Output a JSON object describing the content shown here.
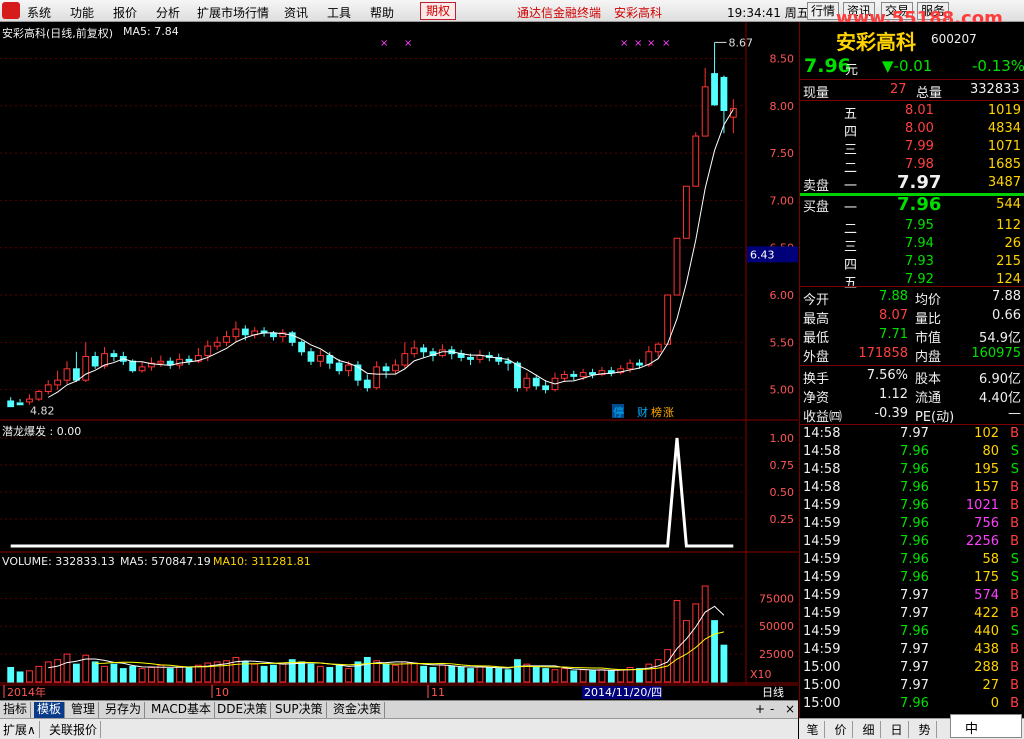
{
  "menu": {
    "items": [
      "系统",
      "功能",
      "报价",
      "分析",
      "扩展市场行情",
      "资讯",
      "工具",
      "帮助"
    ],
    "qq": "期权",
    "marquee1": "通达信金融终端",
    "marquee2": "安彩高科",
    "clock": "19:34:41 周五",
    "tb": [
      "行情",
      "资讯",
      "交易",
      "服务"
    ],
    "watermark": "www.55188.com"
  },
  "chart": {
    "main_title": "安彩高科(日线,前复权)",
    "ma_label": "MA5: 7.84",
    "high_marker": "8.67",
    "low_marker": "4.82",
    "y_ticks": [
      "8.50",
      "8.00",
      "7.50",
      "7.00",
      "6.50",
      "6.00",
      "5.50",
      "5.00"
    ],
    "cursor_price": "6.43",
    "events": [
      "停",
      "财",
      "榜",
      "涨"
    ],
    "ind_title": "潜龙爆发 : 0.00",
    "ind_ticks": [
      "1.00",
      "0.75",
      "0.50",
      "0.25"
    ],
    "vol_title": "VOLUME: 332833.13",
    "vol_ma5": "MA5: 570847.19",
    "vol_ma10": "MA10: 311281.81",
    "vol_ticks": [
      "75000",
      "50000",
      "25000"
    ],
    "vol_unit": "X10",
    "x_labels": [
      "2014年",
      "10",
      "11"
    ],
    "x_cursor": "2014/11/20/四",
    "period": "日线"
  },
  "chart_data": {
    "type": "candlestick",
    "candles": [
      [
        4.88,
        4.82,
        4.92,
        4.86
      ],
      [
        4.86,
        4.84,
        4.9,
        4.87
      ],
      [
        4.87,
        4.9,
        4.95,
        4.84
      ],
      [
        4.9,
        4.98,
        5.0,
        4.88
      ],
      [
        4.98,
        5.05,
        5.1,
        4.95
      ],
      [
        5.05,
        5.1,
        5.2,
        5.0
      ],
      [
        5.1,
        5.22,
        5.3,
        5.06
      ],
      [
        5.22,
        5.1,
        5.4,
        5.08
      ],
      [
        5.1,
        5.35,
        5.5,
        5.08
      ],
      [
        5.35,
        5.25,
        5.4,
        5.22
      ],
      [
        5.25,
        5.38,
        5.45,
        5.22
      ],
      [
        5.38,
        5.35,
        5.42,
        5.3
      ],
      [
        5.35,
        5.3,
        5.4,
        5.26
      ],
      [
        5.3,
        5.2,
        5.32,
        5.18
      ],
      [
        5.2,
        5.24,
        5.3,
        5.18
      ],
      [
        5.24,
        5.28,
        5.34,
        5.2
      ],
      [
        5.28,
        5.3,
        5.36,
        5.24
      ],
      [
        5.3,
        5.26,
        5.34,
        5.22
      ],
      [
        5.26,
        5.32,
        5.38,
        5.22
      ],
      [
        5.32,
        5.3,
        5.36,
        5.26
      ],
      [
        5.3,
        5.36,
        5.44,
        5.28
      ],
      [
        5.36,
        5.46,
        5.52,
        5.3
      ],
      [
        5.46,
        5.5,
        5.56,
        5.42
      ],
      [
        5.5,
        5.56,
        5.62,
        5.46
      ],
      [
        5.56,
        5.64,
        5.72,
        5.5
      ],
      [
        5.64,
        5.58,
        5.68,
        5.52
      ],
      [
        5.58,
        5.62,
        5.66,
        5.54
      ],
      [
        5.62,
        5.6,
        5.66,
        5.56
      ],
      [
        5.6,
        5.56,
        5.62,
        5.52
      ],
      [
        5.56,
        5.6,
        5.64,
        5.5
      ],
      [
        5.6,
        5.5,
        5.62,
        5.46
      ],
      [
        5.5,
        5.4,
        5.52,
        5.36
      ],
      [
        5.4,
        5.3,
        5.44,
        5.26
      ],
      [
        5.3,
        5.36,
        5.42,
        5.24
      ],
      [
        5.36,
        5.28,
        5.4,
        5.22
      ],
      [
        5.28,
        5.2,
        5.32,
        5.16
      ],
      [
        5.2,
        5.26,
        5.3,
        5.14
      ],
      [
        5.26,
        5.1,
        5.3,
        5.04
      ],
      [
        5.1,
        5.02,
        5.16,
        4.98
      ],
      [
        5.02,
        5.24,
        5.3,
        5.0
      ],
      [
        5.24,
        5.2,
        5.28,
        5.12
      ],
      [
        5.2,
        5.26,
        5.32,
        5.16
      ],
      [
        5.26,
        5.38,
        5.5,
        5.22
      ],
      [
        5.38,
        5.44,
        5.52,
        5.34
      ],
      [
        5.44,
        5.4,
        5.48,
        5.34
      ],
      [
        5.4,
        5.36,
        5.44,
        5.3
      ],
      [
        5.36,
        5.42,
        5.48,
        5.34
      ],
      [
        5.42,
        5.38,
        5.46,
        5.32
      ],
      [
        5.38,
        5.34,
        5.42,
        5.3
      ],
      [
        5.34,
        5.32,
        5.38,
        5.26
      ],
      [
        5.32,
        5.36,
        5.42,
        5.28
      ],
      [
        5.36,
        5.34,
        5.4,
        5.3
      ],
      [
        5.34,
        5.3,
        5.38,
        5.26
      ],
      [
        5.3,
        5.28,
        5.34,
        5.2
      ],
      [
        5.28,
        5.02,
        5.3,
        4.98
      ],
      [
        5.02,
        5.12,
        5.18,
        4.98
      ],
      [
        5.12,
        5.04,
        5.16,
        5.0
      ],
      [
        5.04,
        5.0,
        5.1,
        4.96
      ],
      [
        5.0,
        5.12,
        5.18,
        4.98
      ],
      [
        5.12,
        5.16,
        5.2,
        5.08
      ],
      [
        5.16,
        5.14,
        5.2,
        5.1
      ],
      [
        5.14,
        5.18,
        5.22,
        5.1
      ],
      [
        5.18,
        5.16,
        5.22,
        5.12
      ],
      [
        5.16,
        5.2,
        5.24,
        5.14
      ],
      [
        5.2,
        5.18,
        5.24,
        5.14
      ],
      [
        5.18,
        5.22,
        5.26,
        5.16
      ],
      [
        5.22,
        5.28,
        5.32,
        5.18
      ],
      [
        5.28,
        5.26,
        5.32,
        5.22
      ],
      [
        5.26,
        5.4,
        5.46,
        5.24
      ],
      [
        5.4,
        5.48,
        5.5,
        5.34
      ],
      [
        5.48,
        6.0,
        6.0,
        5.48
      ],
      [
        6.0,
        6.6,
        6.6,
        6.0
      ],
      [
        6.6,
        7.15,
        7.15,
        6.88
      ],
      [
        7.15,
        7.68,
        7.72,
        7.15
      ],
      [
        7.68,
        8.2,
        8.4,
        7.68
      ],
      [
        8.34,
        8.01,
        8.67,
        8.0
      ],
      [
        8.3,
        7.95,
        8.32,
        7.71
      ],
      [
        7.88,
        7.97,
        8.07,
        7.71
      ]
    ],
    "vol": [
      13,
      9,
      10,
      14,
      18,
      20,
      25,
      16,
      24,
      18,
      14,
      16,
      12,
      14,
      12,
      13,
      15,
      12,
      14,
      13,
      15,
      17,
      18,
      19,
      22,
      18,
      16,
      14,
      15,
      17,
      20,
      18,
      16,
      14,
      13,
      15,
      12,
      18,
      22,
      19,
      16,
      15,
      18,
      17,
      14,
      13,
      15,
      14,
      13,
      12,
      14,
      13,
      12,
      11,
      20,
      16,
      13,
      12,
      11,
      12,
      10,
      11,
      10,
      11,
      10,
      11,
      13,
      12,
      16,
      20,
      29,
      73,
      55,
      70,
      86,
      55,
      33
    ],
    "ma5_end": 7.84,
    "vol_ma5": 570847.19,
    "vol_ma10": 311281.81
  },
  "quote": {
    "name": "安彩高科",
    "code": "600207",
    "price": "7.96",
    "yuan": "元",
    "chg": "▼-0.01",
    "pct": "-0.13%",
    "xl_label": "现量",
    "xl": "27",
    "zl_label": "总量",
    "zl": "332833",
    "sell": [
      [
        "五",
        "8.01",
        "1019"
      ],
      [
        "四",
        "8.00",
        "4834"
      ],
      [
        "三",
        "7.99",
        "1071"
      ],
      [
        "二",
        "7.98",
        "1685"
      ],
      [
        "一",
        "7.97",
        "3487"
      ]
    ],
    "sell_lbl": "卖盘",
    "buy_lbl": "买盘",
    "buy": [
      [
        "一",
        "7.96",
        "544"
      ],
      [
        "二",
        "7.95",
        "112"
      ],
      [
        "三",
        "7.94",
        "26"
      ],
      [
        "四",
        "7.93",
        "215"
      ],
      [
        "五",
        "7.92",
        "124"
      ]
    ],
    "stats": [
      [
        "今开",
        "7.88",
        "均价",
        "7.88"
      ],
      [
        "最高",
        "8.07",
        "量比",
        "0.66"
      ],
      [
        "最低",
        "7.71",
        "市值",
        "54.9亿"
      ],
      [
        "外盘",
        "171858",
        "内盘",
        "160975"
      ]
    ],
    "stats2": [
      [
        "换手",
        "7.56%",
        "股本",
        "6.90亿"
      ],
      [
        "净资",
        "1.12",
        "流通",
        "4.40亿"
      ],
      [
        "收益㈣",
        "-0.39",
        "PE(动)",
        "—"
      ]
    ],
    "ticks": [
      [
        "14:58",
        "7.97",
        "102",
        "B"
      ],
      [
        "14:58",
        "7.96",
        "80",
        "S"
      ],
      [
        "14:58",
        "7.96",
        "195",
        "S"
      ],
      [
        "14:58",
        "7.96",
        "157",
        "B"
      ],
      [
        "14:59",
        "7.96",
        "1021",
        "B"
      ],
      [
        "14:59",
        "7.96",
        "756",
        "B"
      ],
      [
        "14:59",
        "7.96",
        "2256",
        "B"
      ],
      [
        "14:59",
        "7.96",
        "58",
        "S"
      ],
      [
        "14:59",
        "7.96",
        "175",
        "S"
      ],
      [
        "14:59",
        "7.97",
        "574",
        "B"
      ],
      [
        "14:59",
        "7.97",
        "422",
        "B"
      ],
      [
        "14:59",
        "7.96",
        "440",
        "S"
      ],
      [
        "14:59",
        "7.97",
        "438",
        "B"
      ],
      [
        "15:00",
        "7.97",
        "288",
        "B"
      ],
      [
        "15:00",
        "7.97",
        "27",
        "B"
      ],
      [
        "15:00",
        "7.96",
        "0",
        "B"
      ]
    ]
  },
  "bottom": {
    "tabs": [
      "指标",
      "模板",
      "管理",
      "另存为",
      "MACD基本",
      "DDE决策",
      "SUP决策",
      "资金决策"
    ],
    "tabs2": [
      "扩展∧",
      "关联报价"
    ],
    "rtabs": [
      "笔",
      "价",
      "细",
      "日",
      "势"
    ],
    "ime": "中"
  }
}
